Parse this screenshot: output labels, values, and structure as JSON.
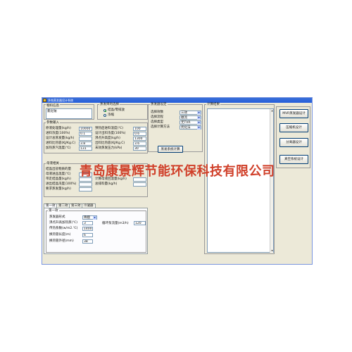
{
  "window": {
    "title": "多效蒸发器设计系统"
  },
  "material": {
    "group_label": "物料信息",
    "value": "氯化钠"
  },
  "purpose": {
    "group_label": "蒸发目的选择",
    "options": [
      "结晶/零排放",
      "浓缩"
    ],
    "selected": 0
  },
  "evaporator_settings": {
    "group_label": "蒸发器设定",
    "rows": [
      {
        "label": "选择效数",
        "value": "三效"
      },
      {
        "label": "选择流程",
        "value": "顺流"
      },
      {
        "label": "选择类型",
        "value": "无TVR"
      },
      {
        "label": "选择计算方法",
        "value": "优化法"
      }
    ],
    "calc_button": "蒸发系统计算"
  },
  "results": {
    "group_label": "计算结果"
  },
  "side_buttons": [
    "MVR蒸发器设计",
    "压缩机设计",
    "分离器设计",
    "真空系统设计"
  ],
  "params_input": {
    "group_label": "参数输入",
    "left": [
      {
        "label": "原液处理量(kg/h)",
        "value": "10000"
      },
      {
        "label": "进料浓度(100%)",
        "value": "0.1"
      },
      {
        "label": "设计总蒸发量(kg/h)",
        "value": ""
      },
      {
        "label": "进料比热容(KJ/Kg.C)",
        "value": "3.8"
      },
      {
        "label": "加热蒸汽温度(℃)",
        "value": "131"
      }
    ],
    "right": [
      {
        "label": "预热后进料温度(℃)",
        "value": "100"
      },
      {
        "label": "设计出料浓度(100%)",
        "value": "0.6"
      },
      {
        "label": "沸点升高度(kg/h)",
        "value": "1300"
      },
      {
        "label": "出料比热容(KJ/Kg.C)",
        "value": "3.6"
      },
      {
        "label": "末效蒸发压力(kPa)",
        "value": "30"
      }
    ]
  },
  "crystal": {
    "group_label": "母液相关",
    "left": [
      {
        "label": "结晶出盐物质的量",
        "value": ""
      },
      {
        "label": "母液进品温度(℃)",
        "value": ""
      },
      {
        "label": "带走结晶量(kg/h)",
        "value": ""
      },
      {
        "label": "进出结晶浓度(100%)",
        "value": ""
      },
      {
        "label": "要求蒸发量(kg/h)",
        "value": ""
      }
    ],
    "right": [
      {
        "label": "计算母液回温量(kg/h)",
        "value": ""
      },
      {
        "label": "总排料量(kg/h)",
        "value": ""
      }
    ]
  },
  "tabs": [
    "第一效",
    "第二效",
    "第三效",
    "冷凝器"
  ],
  "effect1": {
    "group_label": "第一效",
    "rows": [
      {
        "label": "蒸发器形式",
        "value": "降膜",
        "type": "select"
      },
      {
        "label": "沸点升高加热蒸(℃)",
        "value": "3",
        "type": "input"
      },
      {
        "label": "传热系数(w/m2.℃)",
        "value": "1400",
        "type": "input"
      },
      {
        "label": "换热管长度(m)",
        "value": "6",
        "type": "input"
      },
      {
        "label": "换热管外径(mm)",
        "value": "38",
        "type": "input"
      }
    ],
    "circulation": {
      "label": "循环泵流量(m3/h)",
      "value": "120"
    }
  },
  "watermark": "青岛康景辉节能环保科技有限公司"
}
